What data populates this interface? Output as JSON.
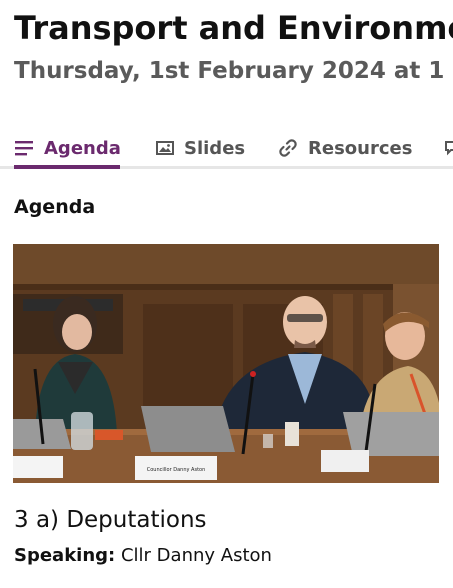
{
  "header": {
    "title": "Transport and Environment",
    "subtitle": "Thursday, 1st February 2024 at 1"
  },
  "tabs": [
    {
      "label": "Agenda",
      "icon": "list-icon",
      "active": true
    },
    {
      "label": "Slides",
      "icon": "image-icon",
      "active": false
    },
    {
      "label": "Resources",
      "icon": "link-icon",
      "active": false
    }
  ],
  "section": {
    "heading": "Agenda"
  },
  "video": {
    "nameplates": [
      "Councillor Danny Aston"
    ]
  },
  "agenda_item": {
    "title": "3 a) Deputations",
    "speaking_label": "Speaking:",
    "speaker": "Cllr Danny Aston"
  },
  "colors": {
    "accent": "#6b2a6e",
    "tab_inactive": "#555555",
    "subtitle": "#5a5a5a"
  }
}
